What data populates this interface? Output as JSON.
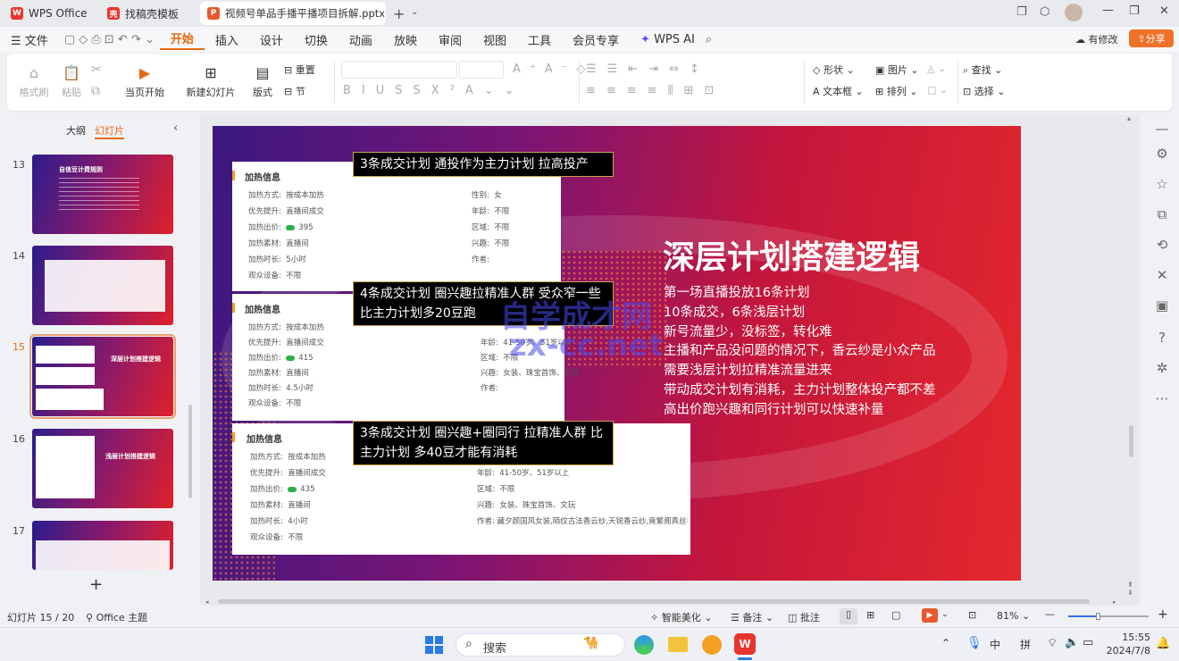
{
  "tabs": [
    {
      "label": "WPS Office",
      "icon": "wps-logo-icon",
      "accent": "#e8342c"
    },
    {
      "label": "找稿壳模板",
      "icon": "template-icon",
      "accent": "#e8342c"
    },
    {
      "label": "视频号单品手播平播项目拆解.pptx",
      "icon": "ppt-file-icon",
      "accent": "#e8582c"
    }
  ],
  "window_controls": {
    "min": "—",
    "max": "❐",
    "close": "✕"
  },
  "menu": {
    "file": "文件",
    "items": [
      "开始",
      "插入",
      "设计",
      "切换",
      "动画",
      "放映",
      "审阅",
      "视图",
      "工具",
      "会员专享"
    ],
    "active": "开始",
    "wps_ai": "WPS AI",
    "modified": "有修改",
    "share": "分享"
  },
  "ribbon": {
    "format_painter": "格式刷",
    "paste": "粘贴",
    "play_from_current": "当页开始",
    "new_slide": "新建幻灯片",
    "layout": "版式",
    "reset": "重置",
    "section": "节",
    "shape": "形状",
    "picture": "图片",
    "textbox": "文本框",
    "arrange": "排列",
    "find": "查找",
    "select": "选择"
  },
  "panel": {
    "outline": "大纲",
    "slides": "幻灯片",
    "add": "+"
  },
  "thumbnails": [
    {
      "num": "13",
      "title": "自信豆计费规则"
    },
    {
      "num": "14",
      "title": ""
    },
    {
      "num": "15",
      "title": "深层计划搭建逻辑"
    },
    {
      "num": "16",
      "title": "浅层计划搭建逻辑"
    },
    {
      "num": "17",
      "title": ""
    }
  ],
  "slide": {
    "title": "深层计划搭建逻辑",
    "body": [
      "第一场直播投放16条计划",
      "10条成交，6条浅层计划",
      "新号流量少，没标签，转化难",
      "主播和产品没问题的情况下，香云纱是小众产品",
      "需要浅层计划拉精准流量进来",
      "带动成交计划有消耗，主力计划整体投产都不差",
      "高出价跑兴趣和同行计划可以快速补量"
    ],
    "watermark": "自学成才网",
    "watermark2": "zx-cc.net",
    "captions": [
      "3条成交计划 通投作为主力计划 拉高投产",
      "4条成交计划 圈兴趣拉精准人群 受众窄一些 比主力计划多20豆跑",
      "3条成交计划 圈兴趣+圈同行 拉精准人群 比主力计划 多40豆才能有消耗"
    ],
    "cards": [
      {
        "header": "加热信息",
        "left": [
          [
            "加热方式:",
            "按成本加热"
          ],
          [
            "优先提升:",
            "直播间成交"
          ],
          [
            "加热出价:",
            "395"
          ],
          [
            "加热素材:",
            "直播间"
          ],
          [
            "加热时长:",
            "5小时"
          ],
          [
            "观众设备:",
            "不限"
          ]
        ],
        "right": [
          [
            "性别:",
            "女"
          ],
          [
            "年龄:",
            "不限"
          ],
          [
            "区域:",
            "不限"
          ],
          [
            "兴趣:",
            "不限"
          ],
          [
            "作者:",
            ""
          ]
        ]
      },
      {
        "header": "加热信息",
        "left": [
          [
            "加热方式:",
            "按成本加热"
          ],
          [
            "优先提升:",
            "直播间成交"
          ],
          [
            "加热出价:",
            "415"
          ],
          [
            "加热素材:",
            "直播间"
          ],
          [
            "加热时长:",
            "4.5小时"
          ],
          [
            "观众设备:",
            "不限"
          ]
        ],
        "right": [
          [
            "年龄:",
            "41-50岁、51岁以上"
          ],
          [
            "区域:",
            "不限"
          ],
          [
            "兴趣:",
            "女装、珠宝首饰、文玩"
          ],
          [
            "作者:",
            ""
          ]
        ]
      },
      {
        "header": "加热信息",
        "left": [
          [
            "加热方式:",
            "按成本加热"
          ],
          [
            "优先提升:",
            "直播间成交"
          ],
          [
            "加热出价:",
            "435"
          ],
          [
            "加热素材:",
            "直播间"
          ],
          [
            "加热时长:",
            "4小时"
          ],
          [
            "观众设备:",
            "不限"
          ]
        ],
        "right": [
          [
            "年龄:",
            "41-50岁、51岁以上"
          ],
          [
            "区域:",
            "不限"
          ],
          [
            "兴趣:",
            "女装、珠宝首饰、文玩"
          ],
          [
            "作者:",
            "藏夕颜国风女装,陌纹古法香云纱,天锐香云纱,竟繁阁真丝香云纱,..."
          ]
        ]
      }
    ]
  },
  "status": {
    "slide_counter": "幻灯片 15 / 20",
    "theme": "Office 主题",
    "beautify": "智能美化",
    "notes": "备注",
    "comments": "批注",
    "zoom": "81%"
  },
  "taskbar": {
    "search": "搜索",
    "ime_mode": "中",
    "ime_pinyin": "拼",
    "time": "15:55",
    "date": "2024/7/8"
  },
  "colors": {
    "accent": "#e8582c",
    "share": "#f07128",
    "active_tab": "#e86a10"
  }
}
